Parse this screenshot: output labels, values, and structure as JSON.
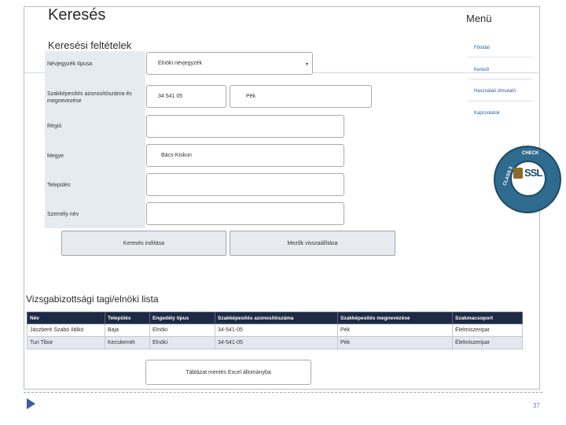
{
  "title": "Keresés",
  "subtitle": "Keresési feltételek",
  "form": {
    "fields": [
      {
        "label": "Névjegyzék típusa",
        "value": "Elnöki névjegyzék"
      },
      {
        "label": "Szakképesítés azonosítószáma és megnevezése",
        "value": "34 541 05",
        "value2": "Pék"
      },
      {
        "label": "Régió",
        "value": ""
      },
      {
        "label": "Megye",
        "value": "Bács-Kiskun"
      },
      {
        "label": "Település",
        "value": ""
      },
      {
        "label": "Személy név",
        "value": ""
      }
    ],
    "search_button": "Keresés indítása",
    "reset_button": "Mezők visszaállítása"
  },
  "menu": {
    "title": "Menü",
    "items": [
      "Főoldal",
      "Kereső",
      "Használati útmutató",
      "Kapcsolatok"
    ]
  },
  "badge": {
    "top": "CHECK",
    "middle": "SSL",
    "bottom": "ELLENŐR",
    "left": "CLASS 3"
  },
  "list": {
    "title": "Vizsgabizottsági tagi/elnöki lista",
    "columns": [
      "Név",
      "Település",
      "Engedély típus",
      "Szakképesítés azonosítószáma",
      "Szakképesítés megnevezése",
      "Szakmacsoport"
    ],
    "rows": [
      [
        "Jászberé Szabó Ildikó",
        "Baja",
        "Elnöki",
        "34-541-05",
        "Pék",
        "Élelmiszeripar"
      ],
      [
        "Turi Tibor",
        "Kecskemét",
        "Elnöki",
        "34-541-05",
        "Pék",
        "Élelmiszeripar"
      ]
    ]
  },
  "export_button": "Táblázat mentés Excel állományba",
  "page_number": "37",
  "colors": {
    "table_header": "#1e2a44",
    "accent_arrow": "#3c5ba3",
    "menu_link": "#2a5a9e"
  }
}
